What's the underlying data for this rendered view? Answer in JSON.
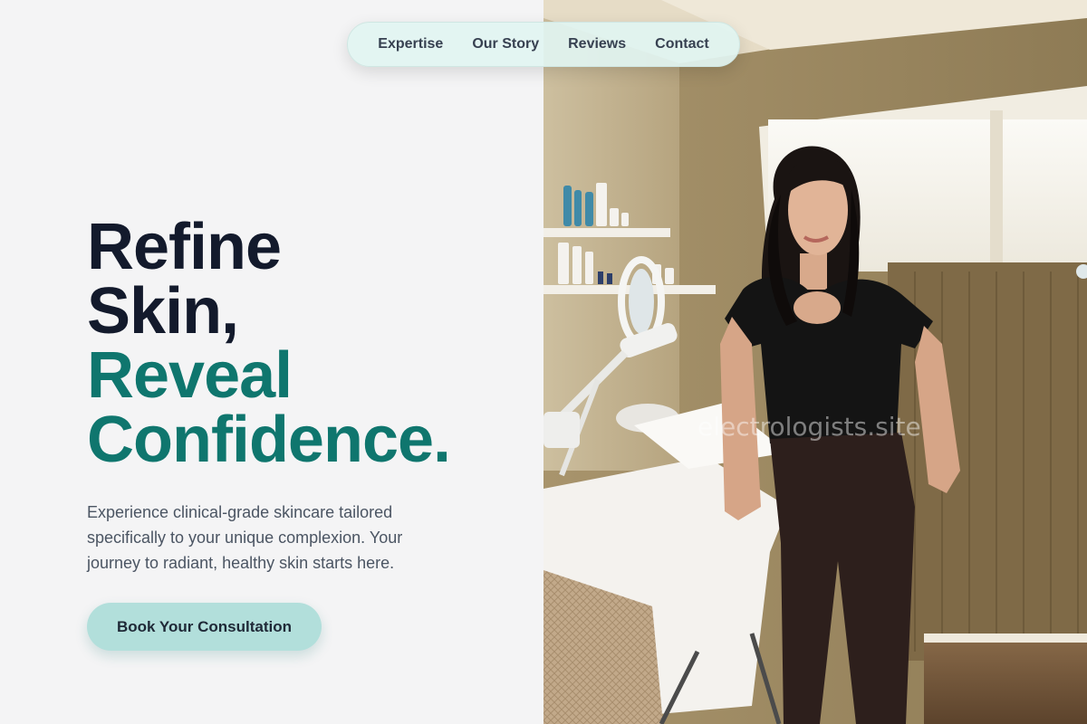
{
  "nav": {
    "items": [
      {
        "label": "Expertise"
      },
      {
        "label": "Our Story"
      },
      {
        "label": "Reviews"
      },
      {
        "label": "Contact"
      }
    ]
  },
  "hero": {
    "headline_lines": [
      "Refine",
      "Skin,",
      "Reveal",
      "Confidence."
    ],
    "subtext": "Experience clinical-grade skincare tailored specifically to your unique complexion. Your journey to radiant, healthy skin starts here.",
    "cta_label": "Book Your Consultation"
  },
  "photo": {
    "description_icon": "esthetician-portrait-photo",
    "watermark": "electrologists.site"
  },
  "colors": {
    "headline_dark": "#131a2c",
    "headline_accent": "#0f766e",
    "cta_bg": "#b2dfdb",
    "nav_bg": "#e1f4f1",
    "page_bg": "#f4f4f5"
  }
}
